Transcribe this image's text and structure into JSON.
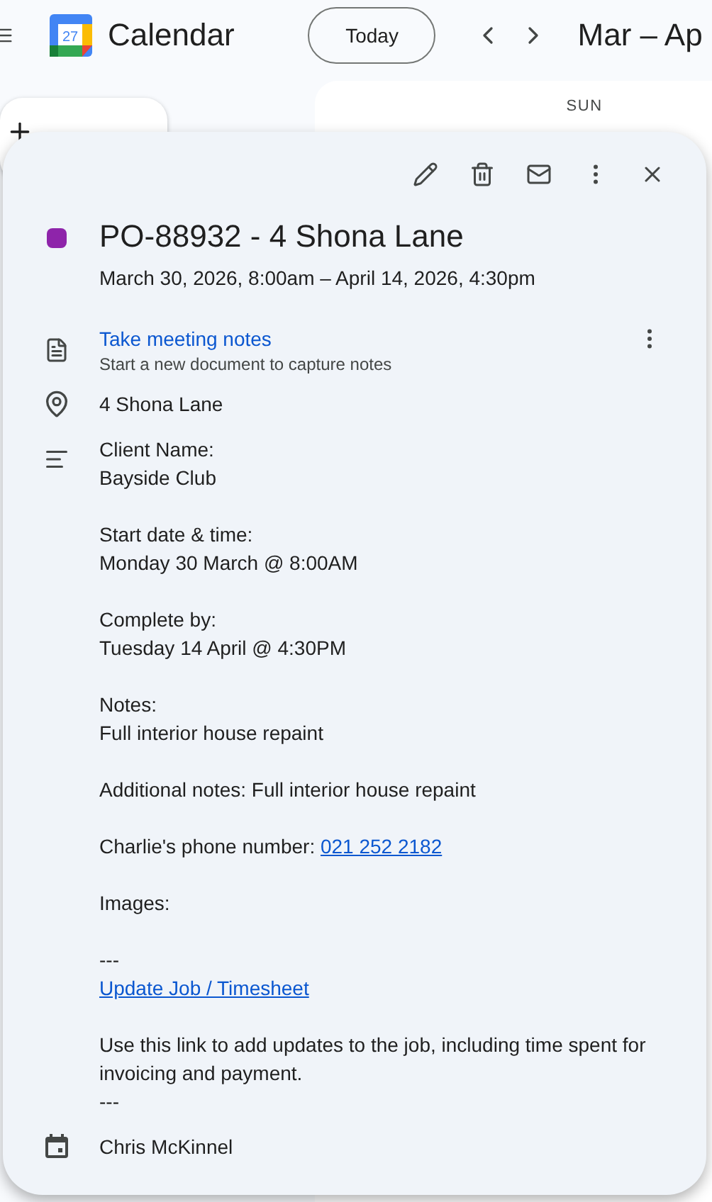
{
  "header": {
    "app_name": "Calendar",
    "logo_day": "27",
    "today_button": "Today",
    "date_range": "Mar – Ap"
  },
  "calendar": {
    "day_header": "SUN"
  },
  "event": {
    "title": "PO-88932 - 4 Shona Lane",
    "color": "#8e24aa",
    "when": "March 30, 2026, 8:00am – April 14, 2026, 4:30pm",
    "notes": {
      "link": "Take meeting notes",
      "hint": "Start a new document to capture notes"
    },
    "location": "4 Shona Lane",
    "description": [
      {
        "kind": "text",
        "text": "Client Name:"
      },
      {
        "kind": "text",
        "text": "Bayside Club"
      },
      {
        "kind": "blank"
      },
      {
        "kind": "text",
        "text": "Start date & time:"
      },
      {
        "kind": "text",
        "text": "Monday 30 March @ 8:00AM"
      },
      {
        "kind": "blank"
      },
      {
        "kind": "text",
        "text": "Complete by:"
      },
      {
        "kind": "text",
        "text": "Tuesday 14 April @ 4:30PM"
      },
      {
        "kind": "blank"
      },
      {
        "kind": "text",
        "text": "Notes:"
      },
      {
        "kind": "text",
        "text": "Full interior house repaint"
      },
      {
        "kind": "blank"
      },
      {
        "kind": "text",
        "text": "Additional notes: Full interior house repaint"
      },
      {
        "kind": "blank"
      },
      {
        "kind": "phone",
        "text": "Charlie's phone number:",
        "link": "021 252 2182"
      },
      {
        "kind": "blank"
      },
      {
        "kind": "text",
        "text": "Images:"
      },
      {
        "kind": "blank"
      },
      {
        "kind": "text",
        "text": "---"
      },
      {
        "kind": "link",
        "text": "Update Job / Timesheet"
      },
      {
        "kind": "blank"
      },
      {
        "kind": "text",
        "text": "Use this link to add updates to the job, including time spent for invoicing and payment."
      },
      {
        "kind": "text",
        "text": "---"
      }
    ],
    "organizer": "Chris McKinnel"
  }
}
